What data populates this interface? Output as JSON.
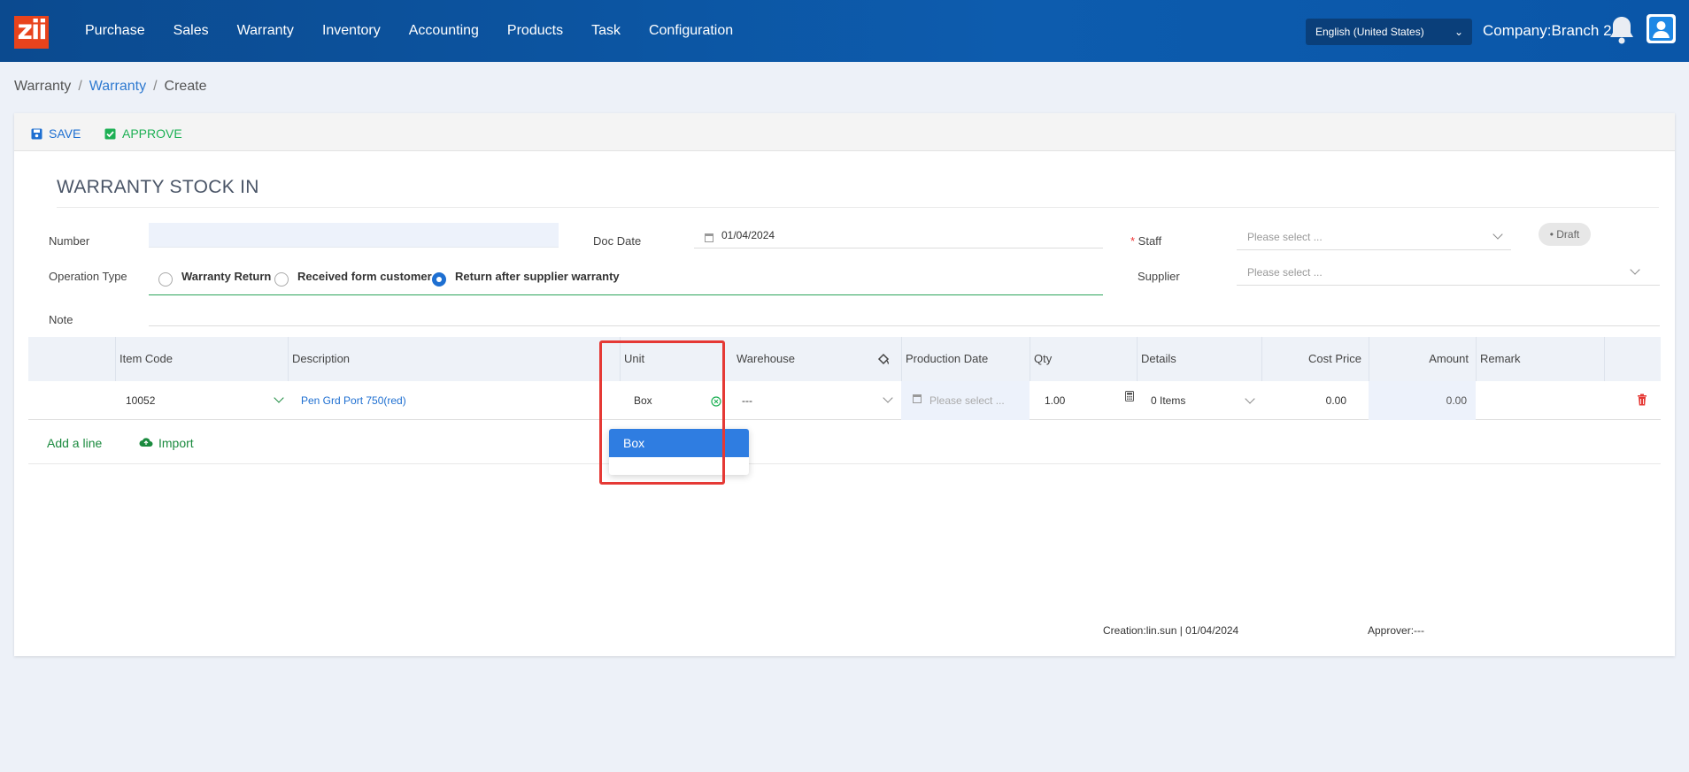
{
  "app": {
    "logo_text": "zii"
  },
  "nav": [
    "Purchase",
    "Sales",
    "Warranty",
    "Inventory",
    "Accounting",
    "Products",
    "Task",
    "Configuration"
  ],
  "header": {
    "language": "English (United States)",
    "company": "Company:Branch 2"
  },
  "breadcrumb": {
    "root": "Warranty",
    "section": "Warranty",
    "current": "Create",
    "sep": "/"
  },
  "toolbar": {
    "save_label": "SAVE",
    "approve_label": "APPROVE"
  },
  "form": {
    "title": "WARRANTY STOCK IN",
    "number_label": "Number",
    "number_value": "",
    "doc_date_label": "Doc Date",
    "doc_date_value": "01/04/2024",
    "staff_label": "Staff",
    "staff_placeholder": "Please select ...",
    "status_badge": "Draft",
    "operation_type_label": "Operation Type",
    "operation_types": [
      {
        "label": "Warranty Return",
        "selected": false
      },
      {
        "label": "Received form customer",
        "selected": false
      },
      {
        "label": "Return after supplier warranty",
        "selected": true
      }
    ],
    "supplier_label": "Supplier",
    "supplier_placeholder": "Please select ...",
    "note_label": "Note"
  },
  "table": {
    "headers": [
      "Item Code",
      "Description",
      "Unit",
      "Warehouse",
      "Production Date",
      "Qty",
      "Details",
      "Cost Price",
      "Amount",
      "Remark"
    ],
    "rows": [
      {
        "item_code": "10052",
        "description": "Pen Grd Port 750(red)",
        "unit": "Box",
        "warehouse": "---",
        "production_date_placeholder": "Please select ...",
        "qty": "1.00",
        "details": "0 Items",
        "cost_price": "0.00",
        "amount": "0.00",
        "remark": ""
      }
    ],
    "add_line_label": "Add a line",
    "import_label": "Import"
  },
  "unit_dropdown": {
    "options": [
      "Box"
    ],
    "highlighted": "Box"
  },
  "footer": {
    "creation": "Creation:lin.sun | 01/04/2024",
    "approver": "Approver:---"
  },
  "colors": {
    "nav_bg": "#0d5cae",
    "accent": "#1e6fd1",
    "success": "#1db054",
    "danger": "#e53935",
    "logo": "#e8431c"
  }
}
